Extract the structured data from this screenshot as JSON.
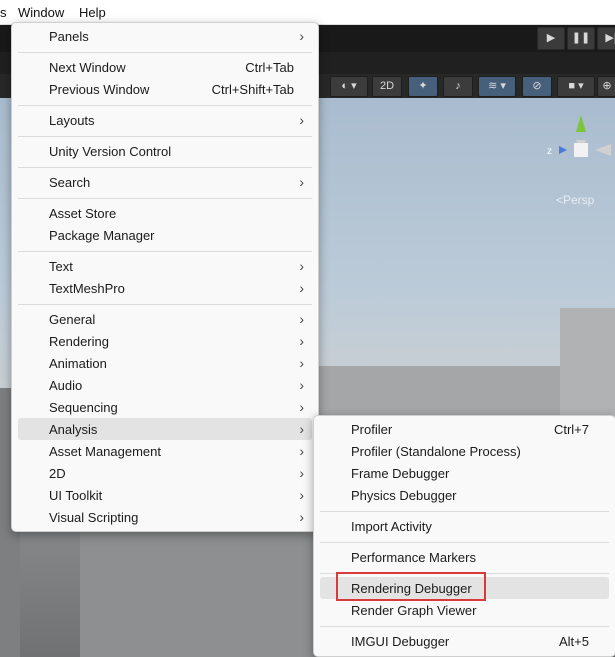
{
  "menubar": {
    "items": [
      "s",
      "Window",
      "Help"
    ]
  },
  "toolbar": {
    "render_mode": "2D",
    "play": "▶",
    "pause": "❚❚",
    "step": "▶|"
  },
  "scene": {
    "persp_label": "<Persp",
    "axis_z": "z"
  },
  "window_menu": {
    "items": [
      {
        "label": "Panels",
        "submenu": true
      },
      {
        "label": "Next Window",
        "shortcut": "Ctrl+Tab"
      },
      {
        "label": "Previous Window",
        "shortcut": "Ctrl+Shift+Tab"
      },
      {
        "label": "Layouts",
        "submenu": true
      },
      {
        "label": "Unity Version Control"
      },
      {
        "label": "Search",
        "submenu": true
      },
      {
        "label": "Asset Store"
      },
      {
        "label": "Package Manager"
      },
      {
        "label": "Text",
        "submenu": true
      },
      {
        "label": "TextMeshPro",
        "submenu": true
      },
      {
        "label": "General",
        "submenu": true
      },
      {
        "label": "Rendering",
        "submenu": true
      },
      {
        "label": "Animation",
        "submenu": true
      },
      {
        "label": "Audio",
        "submenu": true
      },
      {
        "label": "Sequencing",
        "submenu": true
      },
      {
        "label": "Analysis",
        "submenu": true,
        "highlighted": true
      },
      {
        "label": "Asset Management",
        "submenu": true
      },
      {
        "label": "2D",
        "submenu": true
      },
      {
        "label": "UI Toolkit",
        "submenu": true
      },
      {
        "label": "Visual Scripting",
        "submenu": true
      }
    ]
  },
  "analysis_menu": {
    "items": [
      {
        "label": "Profiler",
        "shortcut": "Ctrl+7"
      },
      {
        "label": "Profiler (Standalone Process)"
      },
      {
        "label": "Frame Debugger"
      },
      {
        "label": "Physics Debugger"
      },
      {
        "label": "Import Activity"
      },
      {
        "label": "Performance Markers"
      },
      {
        "label": "Rendering Debugger",
        "highlighted": true
      },
      {
        "label": "Render Graph Viewer"
      },
      {
        "label": "IMGUI Debugger",
        "shortcut": "Alt+5"
      }
    ]
  },
  "colors": {
    "highlight": "#e3e3e3",
    "callout_border": "#d83a3a",
    "menu_bg": "#f9f9f9"
  }
}
